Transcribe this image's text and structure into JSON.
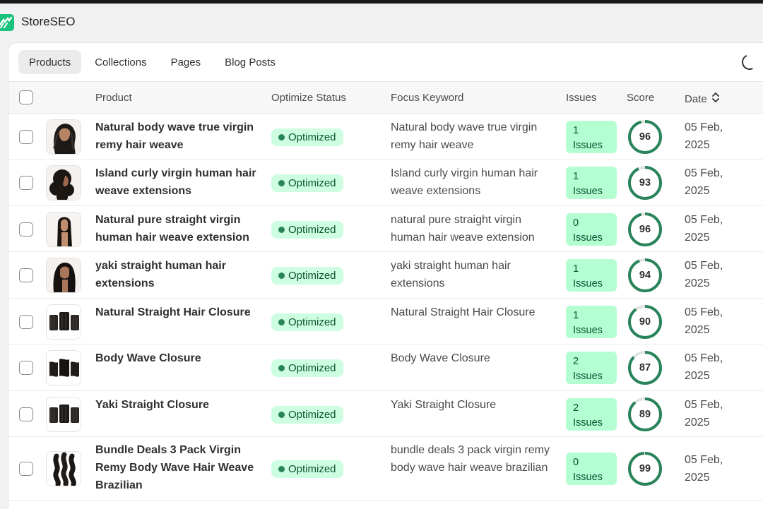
{
  "app": {
    "title": "StoreSEO"
  },
  "tabs": [
    {
      "label": "Products",
      "active": true
    },
    {
      "label": "Collections",
      "active": false
    },
    {
      "label": "Pages",
      "active": false
    },
    {
      "label": "Blog Posts",
      "active": false
    }
  ],
  "table": {
    "headers": {
      "product": "Product",
      "status": "Optimize Status",
      "keyword": "Focus Keyword",
      "issues": "Issues",
      "score": "Score",
      "date": "Date"
    },
    "rows": [
      {
        "product": "Natural body wave true virgin remy hair weave",
        "status": "Optimized",
        "keyword": "Natural body wave true virgin remy hair weave",
        "issues_count": "1",
        "issues_label": "Issues",
        "score": 96,
        "date_line1": "05 Feb,",
        "date_line2": "2025",
        "thumb": "hair-wavy"
      },
      {
        "product": "Island curly virgin human hair weave extensions",
        "status": "Optimized",
        "keyword": "Island curly virgin human hair weave extensions",
        "issues_count": "1",
        "issues_label": "Issues",
        "score": 93,
        "date_line1": "05 Feb,",
        "date_line2": "2025",
        "thumb": "hair-curly"
      },
      {
        "product": "Natural pure straight virgin human hair weave extension",
        "status": "Optimized",
        "keyword": "natural pure straight virgin human hair weave extension",
        "issues_count": "0",
        "issues_label": "Issues",
        "score": 96,
        "date_line1": "05 Feb,",
        "date_line2": "2025",
        "thumb": "hair-straight"
      },
      {
        "product": "yaki straight human hair extensions",
        "status": "Optimized",
        "keyword": "yaki straight human hair extensions",
        "issues_count": "1",
        "issues_label": "Issues",
        "score": 94,
        "date_line1": "05 Feb,",
        "date_line2": "2025",
        "thumb": "hair-yaki"
      },
      {
        "product": "Natural Straight Hair Closure",
        "status": "Optimized",
        "keyword": "Natural Straight Hair Closure",
        "issues_count": "1",
        "issues_label": "Issues",
        "score": 90,
        "date_line1": "05 Feb,",
        "date_line2": "2025",
        "thumb": "closure"
      },
      {
        "product": "Body Wave Closure",
        "status": "Optimized",
        "keyword": "Body Wave Closure",
        "issues_count": "2",
        "issues_label": "Issues",
        "score": 87,
        "date_line1": "05 Feb,",
        "date_line2": "2025",
        "thumb": "closure-wave"
      },
      {
        "product": "Yaki Straight Closure",
        "status": "Optimized",
        "keyword": "Yaki Straight Closure",
        "issues_count": "2",
        "issues_label": "Issues",
        "score": 89,
        "date_line1": "05 Feb,",
        "date_line2": "2025",
        "thumb": "closure"
      },
      {
        "product": "Bundle Deals 3 Pack Virgin Remy Body Wave Hair Weave Brazilian",
        "status": "Optimized",
        "keyword": "bundle deals 3 pack virgin remy body wave hair weave brazilian",
        "issues_count": "0",
        "issues_label": "Issues",
        "score": 99,
        "date_line1": "05 Feb,",
        "date_line2": "2025",
        "thumb": "bundle"
      }
    ]
  },
  "icons": {
    "logo": "storeseo-logo-icon",
    "loading": "loading-spinner-icon",
    "sort": "sort-chevron-icon"
  },
  "colors": {
    "badge_bg": "#cdfee1",
    "badge_dot": "#29845a",
    "issues_bg": "#b4fed2",
    "score_ring": "#29845a",
    "brand": "#19c37d"
  }
}
